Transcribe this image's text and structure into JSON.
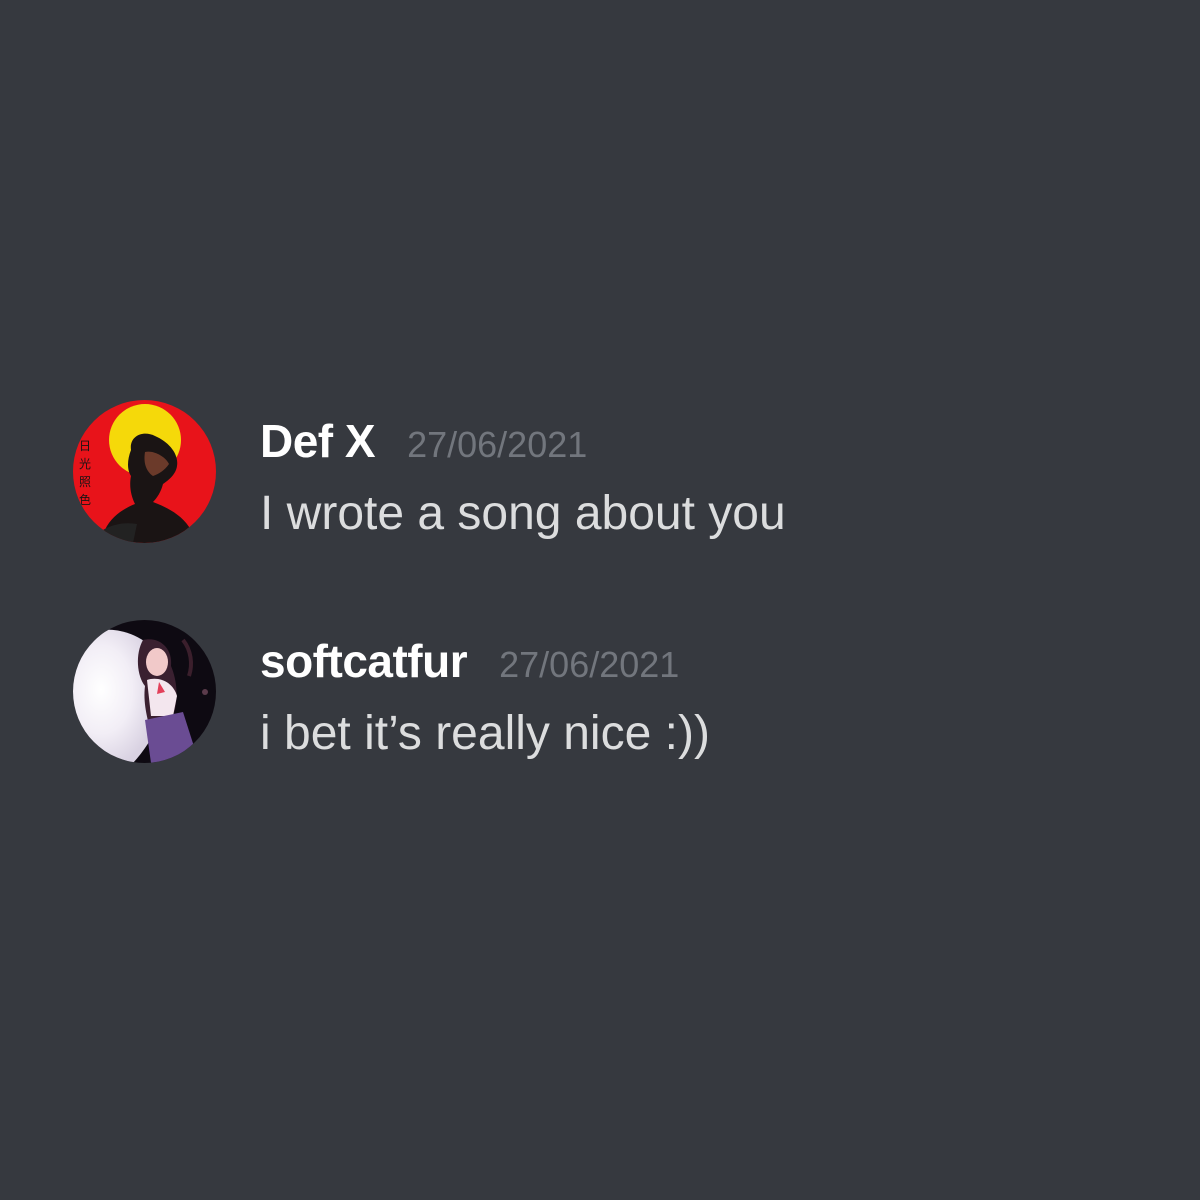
{
  "theme": {
    "background": "#36393f",
    "username_color": "#ffffff",
    "timestamp_color": "#72767d",
    "text_color": "#dcddde"
  },
  "messages": [
    {
      "username": "Def X",
      "timestamp": "27/06/2021",
      "content": "I wrote a song about you",
      "avatar": {
        "description_icon": "red-sun-portrait-avatar",
        "accent": "#e8131a"
      }
    },
    {
      "username": "softcatfur",
      "timestamp": "27/06/2021",
      "content": "i bet it’s really nice :))",
      "avatar": {
        "description_icon": "anime-girl-avatar",
        "accent": "#6a4c93"
      }
    }
  ]
}
